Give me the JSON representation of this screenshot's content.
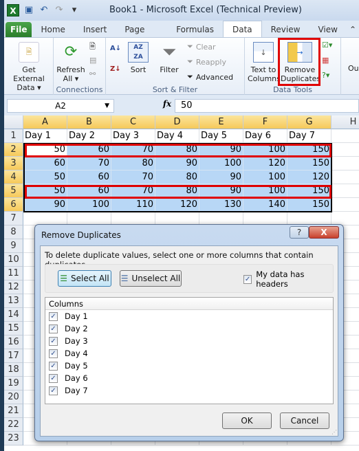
{
  "window": {
    "title": "Book1  -  Microsoft Excel (Technical Preview)"
  },
  "qat": {
    "icons": [
      "excel-logo",
      "save-icon",
      "undo-icon",
      "redo-icon",
      "customize-qat-icon"
    ]
  },
  "tabs": [
    {
      "label": "File"
    },
    {
      "label": "Home"
    },
    {
      "label": "Insert"
    },
    {
      "label": "Page Layout"
    },
    {
      "label": "Formulas"
    },
    {
      "label": "Data",
      "active": true
    },
    {
      "label": "Review"
    },
    {
      "label": "View"
    }
  ],
  "ribbon": {
    "get_external_data": {
      "line1": "Get External",
      "line2": "Data ▾"
    },
    "refresh_all": {
      "line1": "Refresh",
      "line2": "All ▾"
    },
    "connections_label": "Connections",
    "sort_label": "Sort",
    "filter_label": "Filter",
    "clear_label": "Clear",
    "reapply_label": "Reapply",
    "advanced_label": "Advanced",
    "sort_filter_label": "Sort & Filter",
    "text_to_columns": {
      "line1": "Text to",
      "line2": "Columns"
    },
    "remove_duplicates": {
      "line1": "Remove",
      "line2": "Duplicates"
    },
    "data_tools_label": "Data Tools",
    "outline_partial": "Ou"
  },
  "formula_bar": {
    "name_box": "A2",
    "fx": "fx",
    "value": "50"
  },
  "sheet": {
    "columns": [
      "A",
      "B",
      "C",
      "D",
      "E",
      "F",
      "G",
      "H"
    ],
    "rows": [
      "1",
      "2",
      "3",
      "4",
      "5",
      "6",
      "7",
      "8",
      "9",
      "10",
      "11",
      "12",
      "13",
      "14",
      "15",
      "16",
      "17",
      "18",
      "19",
      "20",
      "21",
      "22",
      "23"
    ],
    "headers": [
      "Day 1",
      "Day 2",
      "Day 3",
      "Day 4",
      "Day 5",
      "Day 6",
      "Day 7"
    ],
    "data": [
      [
        "50",
        "60",
        "70",
        "80",
        "90",
        "100",
        "150"
      ],
      [
        "60",
        "70",
        "80",
        "90",
        "100",
        "120",
        "150"
      ],
      [
        "50",
        "60",
        "70",
        "80",
        "90",
        "100",
        "120"
      ],
      [
        "50",
        "60",
        "70",
        "80",
        "90",
        "100",
        "150"
      ],
      [
        "90",
        "100",
        "110",
        "120",
        "130",
        "140",
        "150"
      ]
    ],
    "highlighted_duplicate_rows": [
      2,
      5
    ],
    "accent_red": "#e00000",
    "selection_fill": "#b8d7f6"
  },
  "dialog": {
    "title": "Remove Duplicates",
    "help": "?",
    "close": "X",
    "description": "To delete duplicate values, select one or more columns that contain duplicates.",
    "select_all": "Select All",
    "unselect_all": "Unselect All",
    "headers_checkbox": {
      "label": "My data has headers",
      "checked": true
    },
    "columns_header": "Columns",
    "columns": [
      {
        "label": "Day 1",
        "checked": true
      },
      {
        "label": "Day 2",
        "checked": true
      },
      {
        "label": "Day 3",
        "checked": true
      },
      {
        "label": "Day 4",
        "checked": true
      },
      {
        "label": "Day 5",
        "checked": true
      },
      {
        "label": "Day 6",
        "checked": true
      },
      {
        "label": "Day 7",
        "checked": true
      }
    ],
    "ok": "OK",
    "cancel": "Cancel"
  }
}
